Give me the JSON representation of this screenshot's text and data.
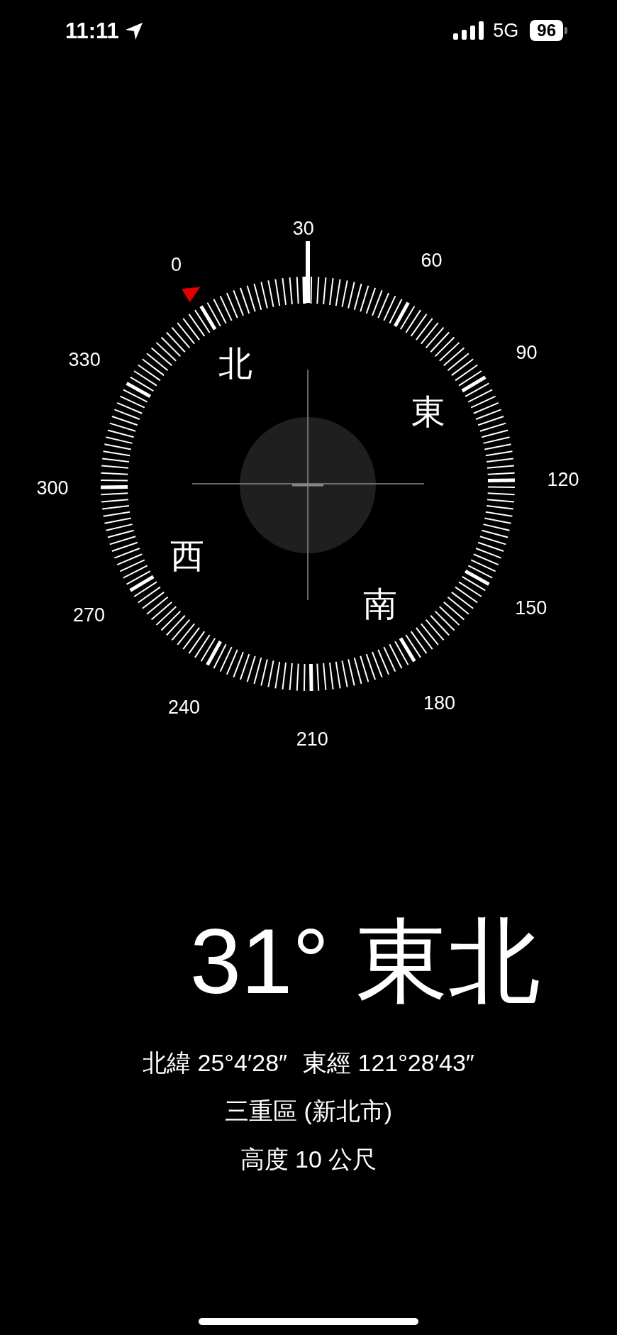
{
  "status_bar": {
    "time": "11:11",
    "network": "5G",
    "battery": "96"
  },
  "compass": {
    "degree_labels": [
      "0",
      "30",
      "60",
      "90",
      "120",
      "150",
      "180",
      "210",
      "240",
      "270",
      "300",
      "330"
    ],
    "cardinal_labels": [
      "北",
      "東",
      "南",
      "西"
    ]
  },
  "heading": {
    "degrees": "31°",
    "direction": "東北"
  },
  "location": {
    "latitude": "北緯 25°4′28″",
    "longitude": "東經 121°28′43″",
    "place": "三重區 (新北市)",
    "altitude": "高度 10 公尺"
  }
}
